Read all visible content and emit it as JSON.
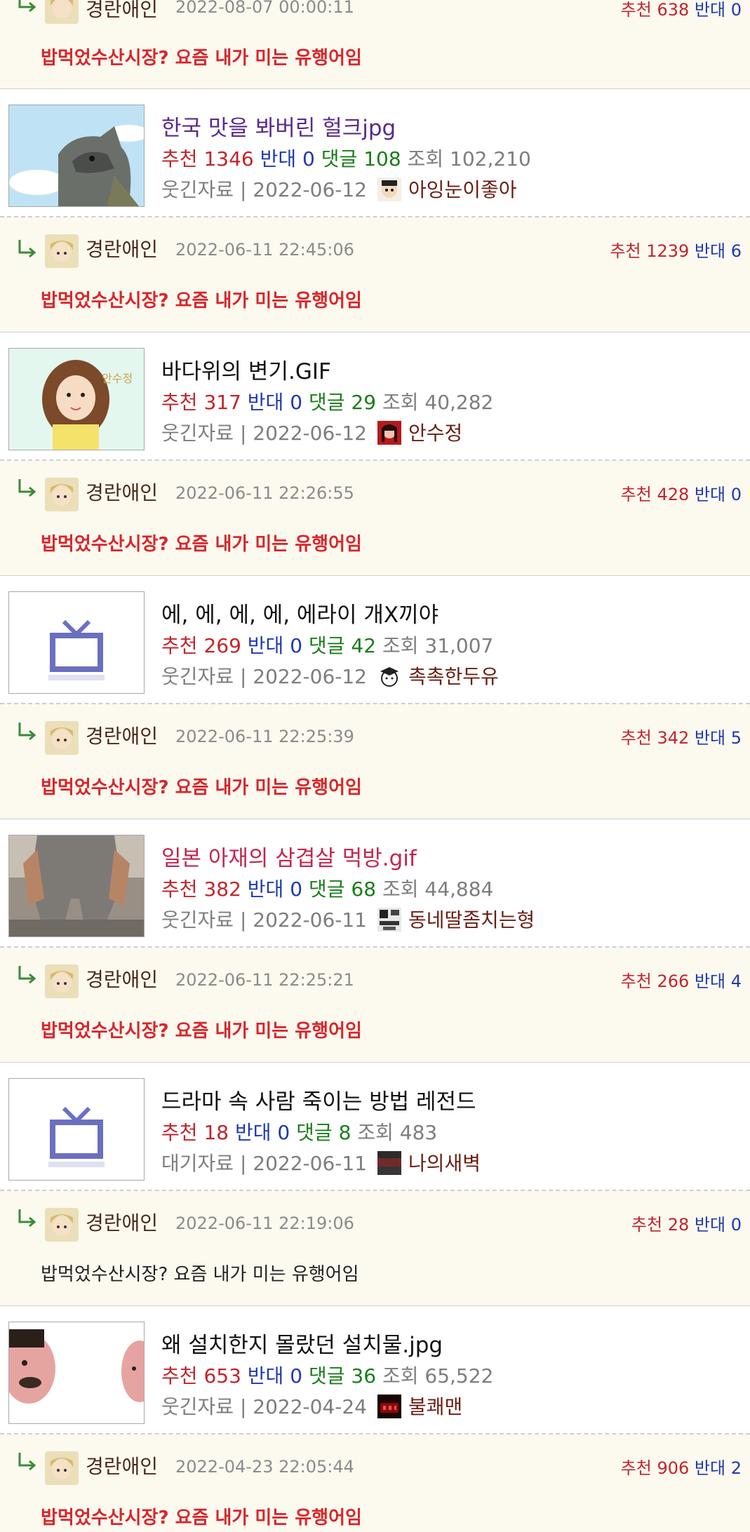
{
  "top_reply": {
    "nick": "경란애인",
    "date": "2022-08-07 00:00:11",
    "up_label": "추천",
    "up": "638",
    "down_label": "반대",
    "down": "0",
    "text": "밥먹었수산시장? 요즘 내가 미는 유행어임"
  },
  "labels": {
    "up": "추천",
    "down": "반대",
    "comments": "댓글",
    "views": "조회"
  },
  "posts": [
    {
      "title": "한국 맛을 봐버린 헐크jpg",
      "up": "1346",
      "down": "0",
      "comments": "108",
      "views": "102,210",
      "category_date": "웃긴자료 | 2022-06-12",
      "author": "아잉눈이좋아",
      "reply": {
        "nick": "경란애인",
        "date": "2022-06-11 22:45:06",
        "up": "1239",
        "down": "6",
        "text": "밥먹었수산시장? 요즘 내가 미는 유행어임"
      }
    },
    {
      "title": "바다위의 변기.GIF",
      "up": "317",
      "down": "0",
      "comments": "29",
      "views": "40,282",
      "category_date": "웃긴자료 | 2022-06-12",
      "author": "안수정",
      "thumb_text": "안수정",
      "reply": {
        "nick": "경란애인",
        "date": "2022-06-11 22:26:55",
        "up": "428",
        "down": "0",
        "text": "밥먹었수산시장? 요즘 내가 미는 유행어임"
      }
    },
    {
      "title": "에, 에, 에, 에, 에라이 개X끼야",
      "up": "269",
      "down": "0",
      "comments": "42",
      "views": "31,007",
      "category_date": "웃긴자료 | 2022-06-12",
      "author": "촉촉한두유",
      "reply": {
        "nick": "경란애인",
        "date": "2022-06-11 22:25:39",
        "up": "342",
        "down": "5",
        "text": "밥먹었수산시장? 요즘 내가 미는 유행어임"
      }
    },
    {
      "title": "일본 아재의 삼겹살 먹방.gif",
      "up": "382",
      "down": "0",
      "comments": "68",
      "views": "44,884",
      "category_date": "웃긴자료 | 2022-06-11",
      "author": "동네딸좀치는형",
      "reply": {
        "nick": "경란애인",
        "date": "2022-06-11 22:25:21",
        "up": "266",
        "down": "4",
        "text": "밥먹었수산시장? 요즘 내가 미는 유행어임"
      }
    },
    {
      "title": "드라마 속 사람 죽이는 방법 레전드",
      "up": "18",
      "down": "0",
      "comments": "8",
      "views": "483",
      "category_date": "대기자료 | 2022-06-11",
      "author": "나의새벽",
      "reply": {
        "nick": "경란애인",
        "date": "2022-06-11 22:19:06",
        "up": "28",
        "down": "0",
        "text": "밥먹었수산시장? 요즘 내가 미는 유행어임"
      }
    },
    {
      "title": "왜 설치한지 몰랐던 설치물.jpg",
      "up": "653",
      "down": "0",
      "comments": "36",
      "views": "65,522",
      "category_date": "웃긴자료 | 2022-04-24",
      "author": "불쾌맨",
      "reply": {
        "nick": "경란애인",
        "date": "2022-04-23 22:05:44",
        "up": "906",
        "down": "2",
        "text": "밥먹었수산시장? 요즘 내가 미는 유행어임"
      }
    }
  ],
  "colors": {
    "reply_bg": "#fcf9ef",
    "reply_text": "#d8262b",
    "up": "#c2252b",
    "down": "#1f3ab0",
    "comments": "#1a7d1a"
  }
}
